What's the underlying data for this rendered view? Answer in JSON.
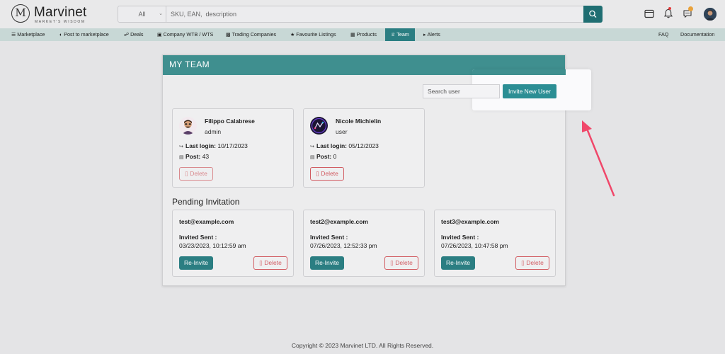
{
  "header": {
    "logo_letter": "M",
    "brand": "Marvinet",
    "tagline": "MARKET'S WISDOM",
    "search_category": "All",
    "search_placeholder": "SKU, EAN,  description"
  },
  "nav": {
    "items": [
      {
        "label": "Marketplace",
        "icon": "list-icon"
      },
      {
        "label": "Post to marketplace",
        "icon": "globe-icon"
      },
      {
        "label": "Deals",
        "icon": "handshake-icon"
      },
      {
        "label": "Company WTB / WTS",
        "icon": "briefcase-icon"
      },
      {
        "label": "Trading Companies",
        "icon": "factory-icon"
      },
      {
        "label": "Favourite Listings",
        "icon": "star-icon"
      },
      {
        "label": "Products",
        "icon": "barcode-icon"
      },
      {
        "label": "Team",
        "icon": "team-icon",
        "active": true
      },
      {
        "label": "Alerts",
        "icon": "megaphone-icon"
      }
    ],
    "right": [
      {
        "label": "FAQ"
      },
      {
        "label": "Documentation"
      }
    ]
  },
  "team": {
    "title": "MY TEAM",
    "search_placeholder": "Search user",
    "invite_label": "Invite New User",
    "members": [
      {
        "name": "Filippo Calabrese",
        "role": "admin",
        "last_login_label": "Last login:",
        "last_login": "10/17/2023",
        "post_label": "Post:",
        "posts": "43",
        "delete_label": "Delete"
      },
      {
        "name": "Nicole Michielin",
        "role": "user",
        "last_login_label": "Last login:",
        "last_login": "05/12/2023",
        "post_label": "Post:",
        "posts": "0",
        "delete_label": "Delete"
      }
    ],
    "pending_title": "Pending Invitation",
    "invitations": [
      {
        "email": "test@example.com",
        "sent_label": "Invited Sent :",
        "sent": "03/23/2023, 10:12:59 am",
        "reinvite_label": "Re-Invite",
        "delete_label": "Delete"
      },
      {
        "email": "test2@example.com",
        "sent_label": "Invited Sent :",
        "sent": "07/26/2023, 12:52:33 pm",
        "reinvite_label": "Re-Invite",
        "delete_label": "Delete"
      },
      {
        "email": "test3@example.com",
        "sent_label": "Invited Sent :",
        "sent": "07/26/2023, 10:47:58 pm",
        "reinvite_label": "Re-Invite",
        "delete_label": "Delete"
      }
    ]
  },
  "footer": {
    "copyright": "Copyright © 2023 Marvinet LTD. All Rights Reserved."
  },
  "colors": {
    "primary": "#2b7e82",
    "header_band": "#3f8f8f",
    "danger": "#d15b61",
    "annotation_arrow": "#f0476a"
  }
}
